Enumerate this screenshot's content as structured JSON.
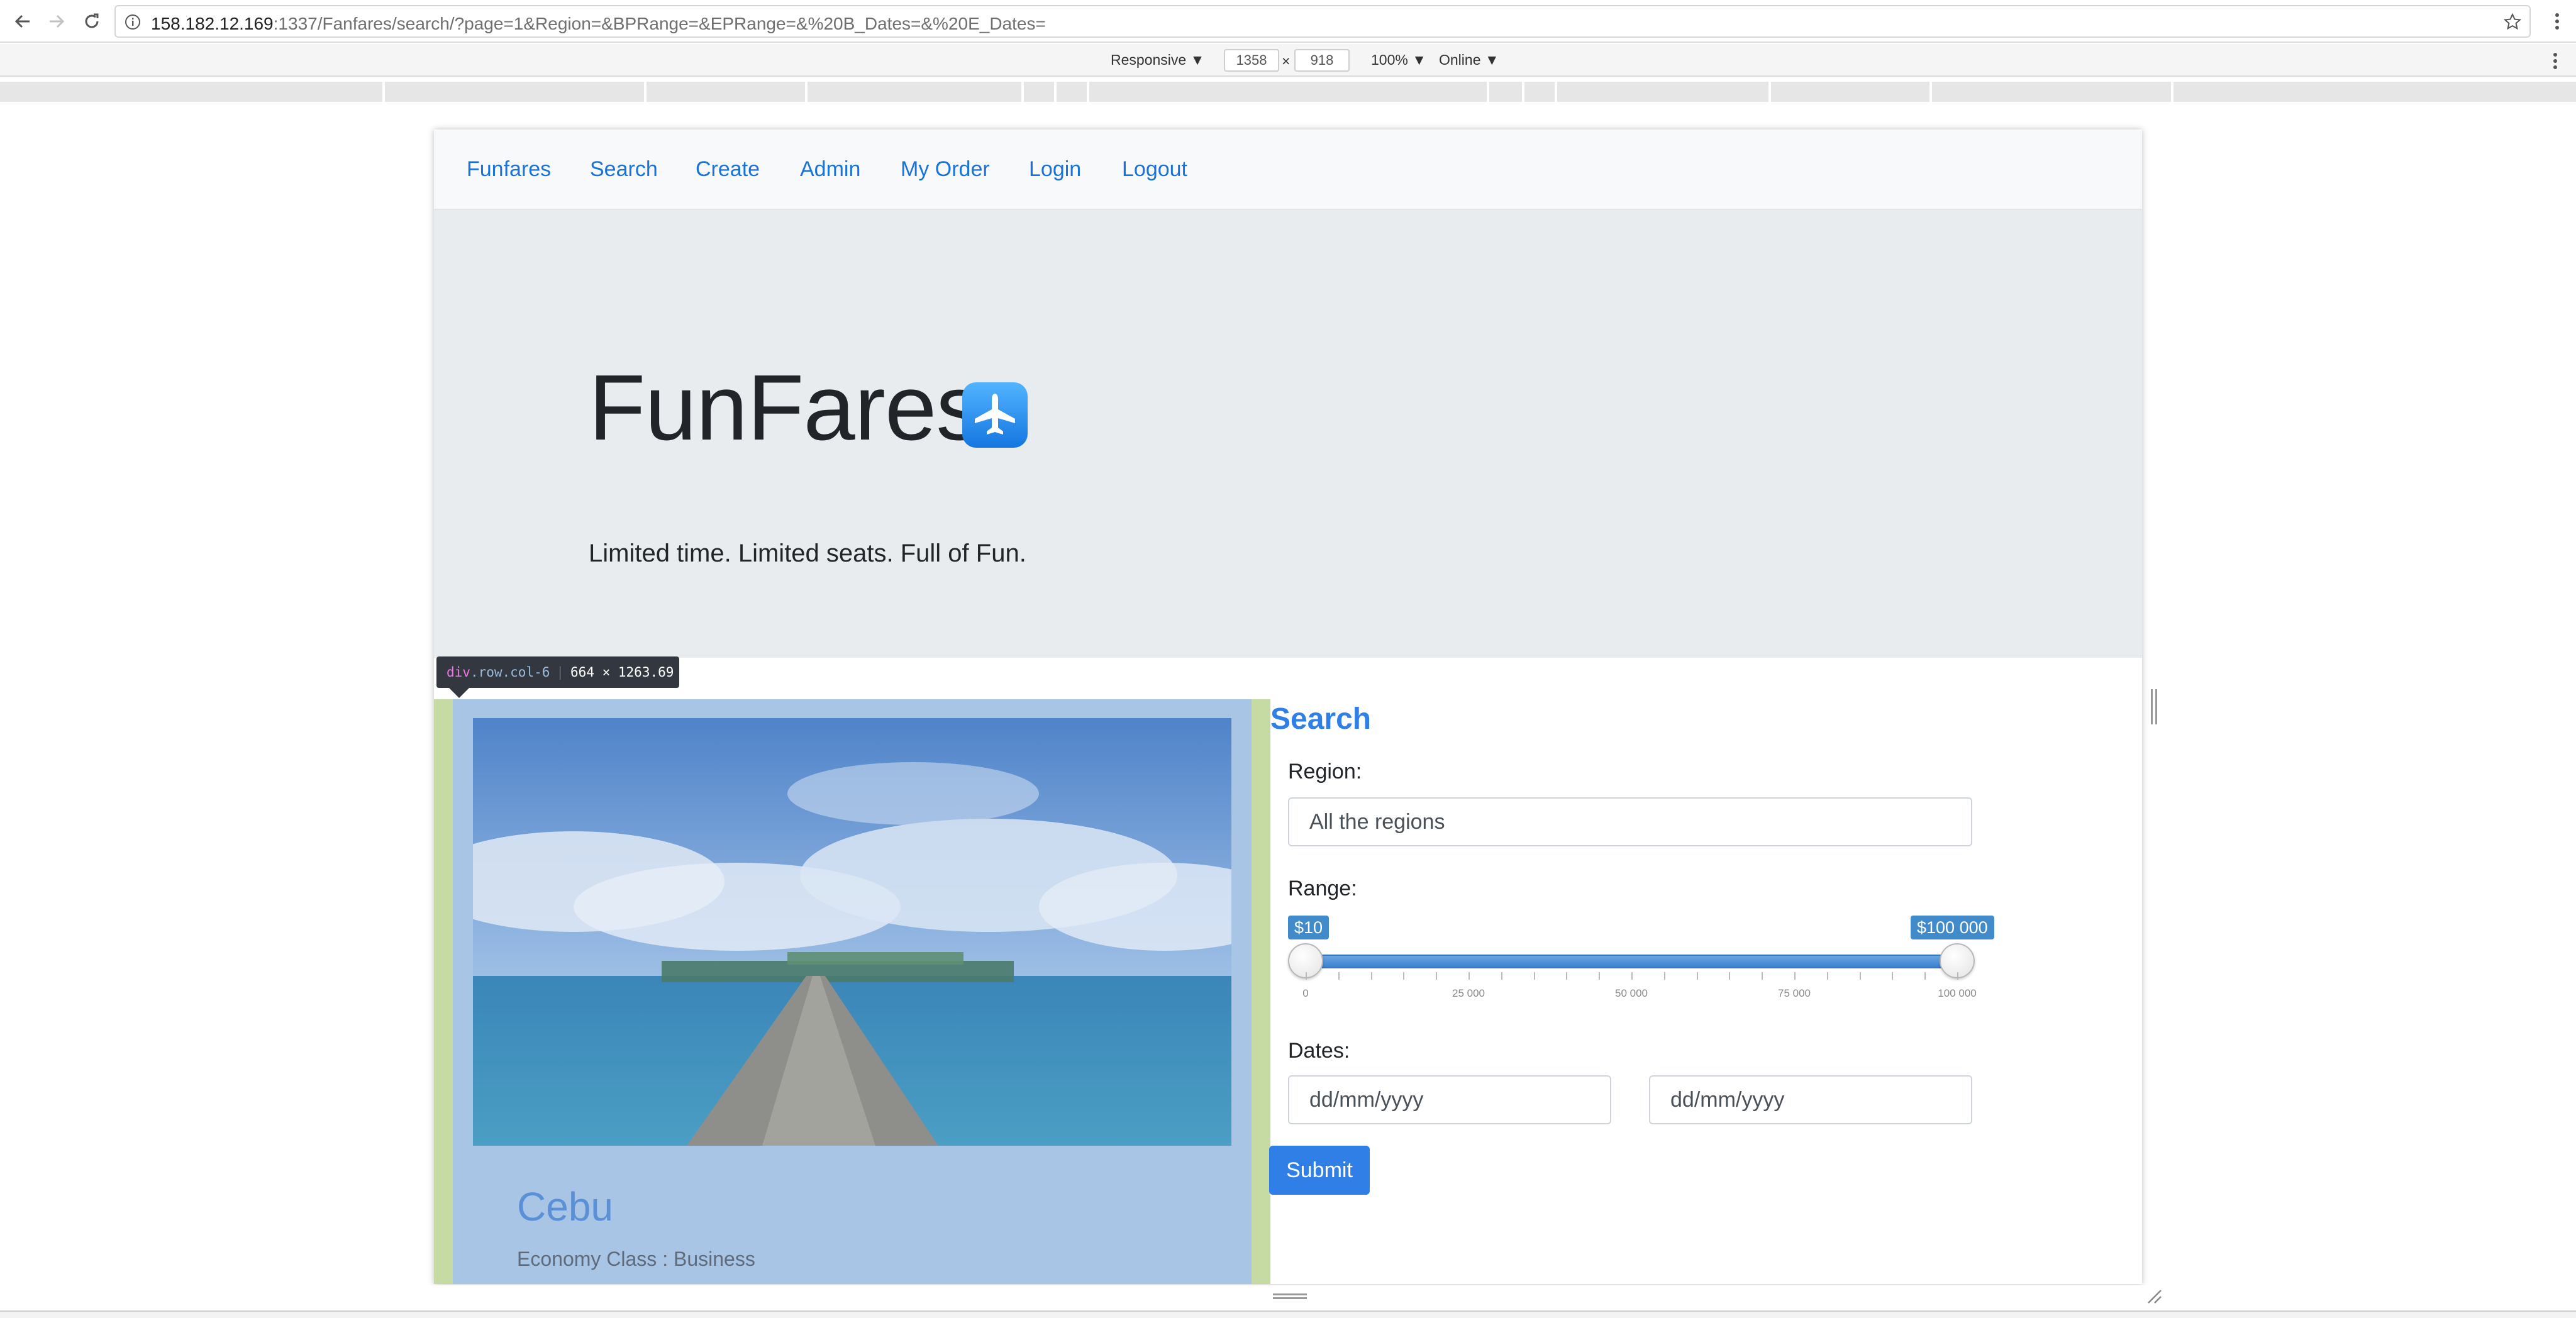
{
  "browser": {
    "url_host": "158.182.12.169",
    "url_rest": ":1337/Fanfares/search/?page=1&Region=&BPRange=&EPRange=&%20B_Dates=&%20E_Dates="
  },
  "devtools": {
    "device": "Responsive ▼",
    "width": "1358",
    "times": "×",
    "height": "918",
    "zoom": "100% ▼",
    "network": "Online ▼"
  },
  "nav": {
    "items": [
      {
        "label": "Funfares"
      },
      {
        "label": "Search"
      },
      {
        "label": "Create"
      },
      {
        "label": "Admin"
      },
      {
        "label": "My Order"
      },
      {
        "label": "Login"
      },
      {
        "label": "Logout"
      }
    ]
  },
  "hero": {
    "title": "FunFares",
    "tagline": "Limited time. Limited seats. Full of Fun."
  },
  "inspector": {
    "tag": "div",
    "classes": ".row.col-6",
    "size": "664 × 1263.69"
  },
  "result": {
    "title": "Cebu",
    "class_line": "Economy Class : Business"
  },
  "search": {
    "heading": "Search",
    "region_label": "Region:",
    "region_value": "All the regions",
    "range_label": "Range:",
    "range_min_badge": "$10",
    "range_max_badge": "$100 000",
    "range_min_value": 10,
    "range_max_value": 100000,
    "range_ticks": [
      "0",
      "25 000",
      "50 000",
      "75 000",
      "100 000"
    ],
    "dates_label": "Dates:",
    "date_from_placeholder": "dd/mm/yyyy",
    "date_to_placeholder": "dd/mm/yyyy",
    "submit_label": "Submit"
  },
  "colors": {
    "link": "#1a73d9",
    "primary": "#2f7fe6",
    "jumbotron": "#e9ecef",
    "inspector_highlight": "#a8c5e6"
  }
}
